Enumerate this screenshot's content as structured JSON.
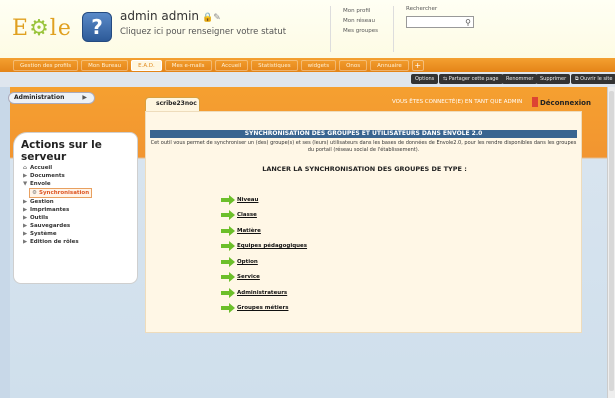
{
  "header": {
    "logo_text": "EOLE",
    "user_name": "admin admin",
    "user_status": "Cliquez ici pour renseigner votre statut",
    "profile_links": [
      "Mon profil",
      "Mon réseau",
      "Mes groupes"
    ],
    "search_label": "Rechercher"
  },
  "nav": {
    "items": [
      "Gestion des profils",
      "Mon Bureau",
      "E.A.D.",
      "Mes e-mails",
      "Accueil",
      "Statistiques",
      "widgets",
      "Onos",
      "Annuaire"
    ],
    "active_index": 2
  },
  "toolbar": {
    "buttons": [
      "Options",
      "Partager cette page",
      "Renommer",
      "Supprimer",
      "Ouvrir le site"
    ]
  },
  "sidebar": {
    "tab_label": "Administration",
    "title": "Actions sur le serveur",
    "items": [
      {
        "label": "Accueil",
        "type": "home"
      },
      {
        "label": "Documents",
        "type": "collapsed"
      },
      {
        "label": "Envole",
        "type": "expanded"
      },
      {
        "label": "Synchronisation",
        "type": "selected"
      },
      {
        "label": "Gestion",
        "type": "collapsed"
      },
      {
        "label": "Imprimantes",
        "type": "collapsed"
      },
      {
        "label": "Outils",
        "type": "collapsed"
      },
      {
        "label": "Sauvegardes",
        "type": "collapsed"
      },
      {
        "label": "Système",
        "type": "collapsed"
      },
      {
        "label": "Edition de rôles",
        "type": "collapsed"
      }
    ]
  },
  "content": {
    "server_tab": "scribe23noc",
    "connected_text": "VOUS ÊTES CONNECTÉ(E) EN TANT QUE ADMIN",
    "logout_label": "Déconnexion",
    "title": "SYNCHRONISATION DES GROUPES ET UTILISATEURS DANS ENVOLE 2.0",
    "description": "Cet outil vous permet de synchroniser un (des) groupe(s) et ses (leurs) utilisateurs dans les bases de données de Envole2.0, pour les rendre disponibles dans les groupes du portail (réseau social de l'établissement).",
    "subtitle": "LANCER LA SYNCHRONISATION DES GROUPES DE TYPE :",
    "sync_links": [
      "Niveau",
      "Classe",
      "Matière",
      "Equipes pédagogiques",
      "Option",
      "Service",
      "Administrateurs",
      "Groupes métiers"
    ]
  },
  "colors": {
    "orange": "#f29530",
    "title_bar": "#3a6590",
    "arrow_green": "#6cbf2a"
  }
}
